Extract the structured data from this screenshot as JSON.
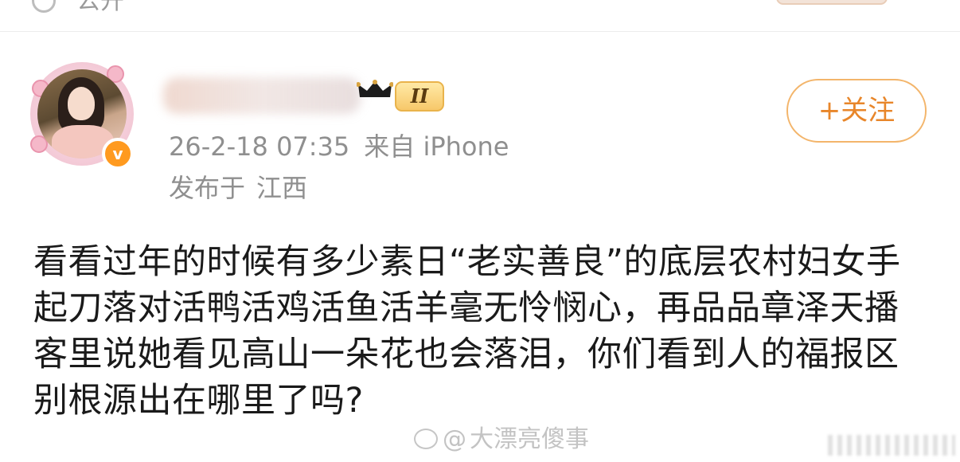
{
  "header": {
    "visibility_label": "公开"
  },
  "post": {
    "author": {
      "verified_badge": "v",
      "level_badge": "II"
    },
    "timestamp": "26-2-18 07:35",
    "source": "来自 iPhone",
    "location_prefix": "发布于",
    "location": "江西",
    "follow_label": "+关注",
    "content": "看看过年的时候有多少素日“老实善良”的底层农村妇女手起刀落对活鸭活鸡活鱼活羊毫无怜悯心，再品品章泽天播客里说她看见高山一朵花也会落泪，你们看到人的福报区别根源出在哪里了吗?"
  },
  "watermark": {
    "at": "@",
    "handle": "大漂亮傻事"
  },
  "icons": {
    "visibility": "globe-icon",
    "crown": "crown-icon",
    "verified": "verified-badge-icon",
    "watermark_logo": "weibo-logo-icon"
  },
  "colors": {
    "accent_orange": "#e8862a",
    "follow_border": "#f3b56b",
    "meta_gray": "#8f8f8f",
    "verified_orange": "#ff9a1f"
  }
}
